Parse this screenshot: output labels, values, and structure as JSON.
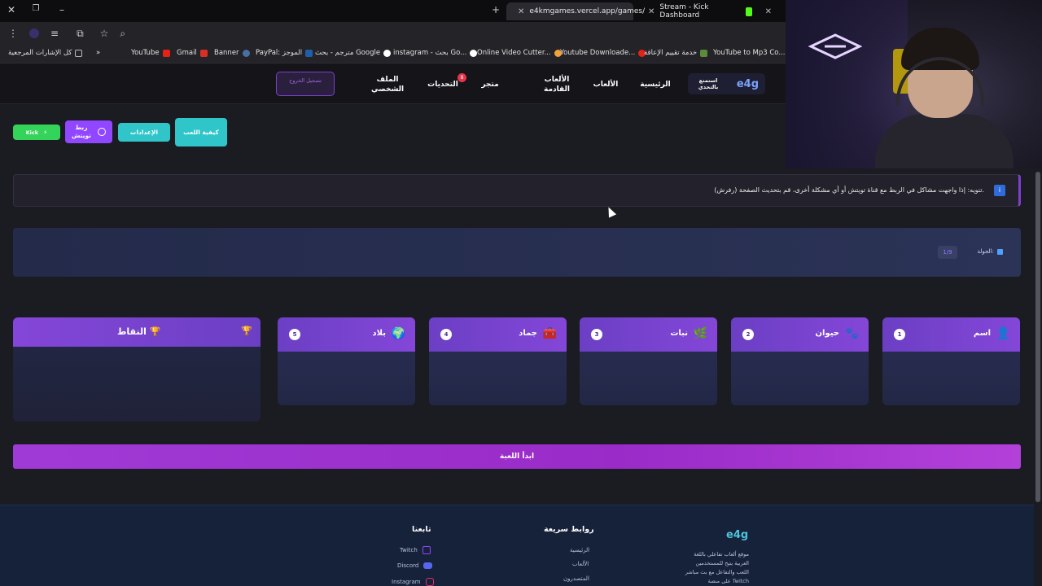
{
  "browser": {
    "tabs": [
      {
        "label": "e4kmgames.vercel.app/games/",
        "active": true
      },
      {
        "label": "Stream - Kick Dashboard",
        "active": false
      }
    ],
    "bookmarks": [
      "YouTube",
      "Gmail",
      "Banner",
      "PayPal: الموجز",
      "مترجم - بحث Google",
      "instagram - بحث Go...",
      "Online Video Cutter...",
      "Youtube Downloade...",
      "خدمة تقييم الإعاقة",
      "YouTube to Mp3 Co...",
      "كل الإشارات المرجعية"
    ]
  },
  "nav": {
    "brand": "e4g",
    "brand_tag": "استمتع بالتحدي",
    "home": "الرئيسية",
    "games": "الألعاب",
    "upcoming": "الألعاب القادمة",
    "store": "متجر",
    "challenges": "التحديات",
    "challenges_badge": "8",
    "profile": "الملف الشخصي",
    "login": "تسجيل الخروج"
  },
  "toolbar": {
    "kick_label": "Kick",
    "link_twitch": "ربط تويتش",
    "settings": "الإعدادات",
    "how_to_play": "كيفية اللعب"
  },
  "notice": {
    "text": "تنويه: إذا واجهت مشاكل في الربط مع قناة تويتش أو أي مشكلة أخرى، قم بتحديث الصفحة (رفرش).",
    "icon": "i"
  },
  "round": {
    "label": "الجولة:",
    "value": "1/9"
  },
  "categories": [
    {
      "num": "1",
      "name": "اسم",
      "icon": "👤"
    },
    {
      "num": "2",
      "name": "حيوان",
      "icon": "🐾"
    },
    {
      "num": "3",
      "name": "نبات",
      "icon": "🌿"
    },
    {
      "num": "4",
      "name": "جماد",
      "icon": "🧰"
    },
    {
      "num": "5",
      "name": "بلاد",
      "icon": "🌍"
    }
  ],
  "points": {
    "title": "النقاط",
    "icon": "🏆"
  },
  "start_button": "ابدأ اللعبة",
  "footer": {
    "brand": "e4g",
    "description": "موقع ألعاب تفاعلي باللغة العربية يتيح للمستخدمين اللعب والتفاعل مع بث مباشر على منصة Twitch",
    "quick_links_title": "روابط سريعة",
    "quick_links": [
      "الرئيسية",
      "الألعاب",
      "المتصدرون"
    ],
    "follow_title": "تابعنا",
    "follow_links": [
      "Twitch",
      "Discord",
      "Instagram"
    ]
  },
  "colors": {
    "accent_purple": "#8446d8",
    "accent_teal": "#3ad1d6",
    "kick_green": "#53fc18",
    "footer_bg": "#16213a"
  }
}
